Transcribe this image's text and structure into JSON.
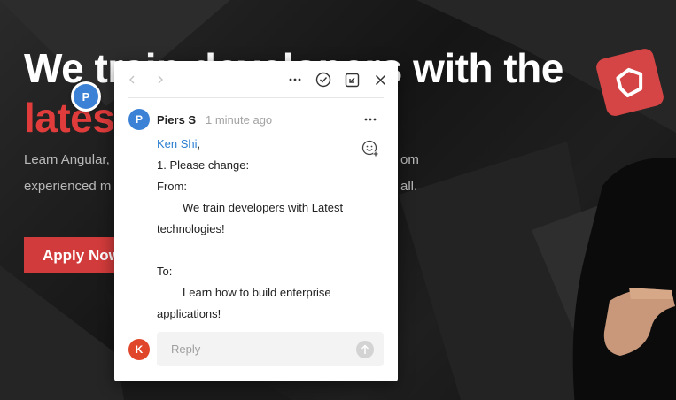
{
  "hero": {
    "title_line1": "We train developers with the",
    "title_line2": "latest technologies",
    "subtitle_line1_left": "Learn Angular,",
    "subtitle_line1_right": "om",
    "subtitle_line2_left": "experienced m",
    "subtitle_line2_right": "all.",
    "apply_label": "Apply Now"
  },
  "marker": {
    "initial": "P"
  },
  "comment": {
    "author_initial": "P",
    "author_name": "Piers S",
    "time": "1 minute ago",
    "mention": "Ken Shi",
    "mention_suffix": ",",
    "lines": [
      "1. Please change:",
      "From:",
      "We train developers with Latest",
      "technologies!",
      "To:",
      "Learn how to build enterprise",
      "applications!"
    ]
  },
  "reply": {
    "user_initial": "K",
    "placeholder": "Reply"
  },
  "colors": {
    "accent_red": "#d23b3b",
    "marker_blue": "#3b82d6",
    "mention_blue": "#2d7fd0",
    "reply_avatar": "#e0462a"
  },
  "icons": {
    "toolbar": [
      "chevron-left-icon",
      "chevron-right-icon",
      "more-icon",
      "resolve-check-icon",
      "pop-out-icon",
      "close-icon"
    ]
  }
}
